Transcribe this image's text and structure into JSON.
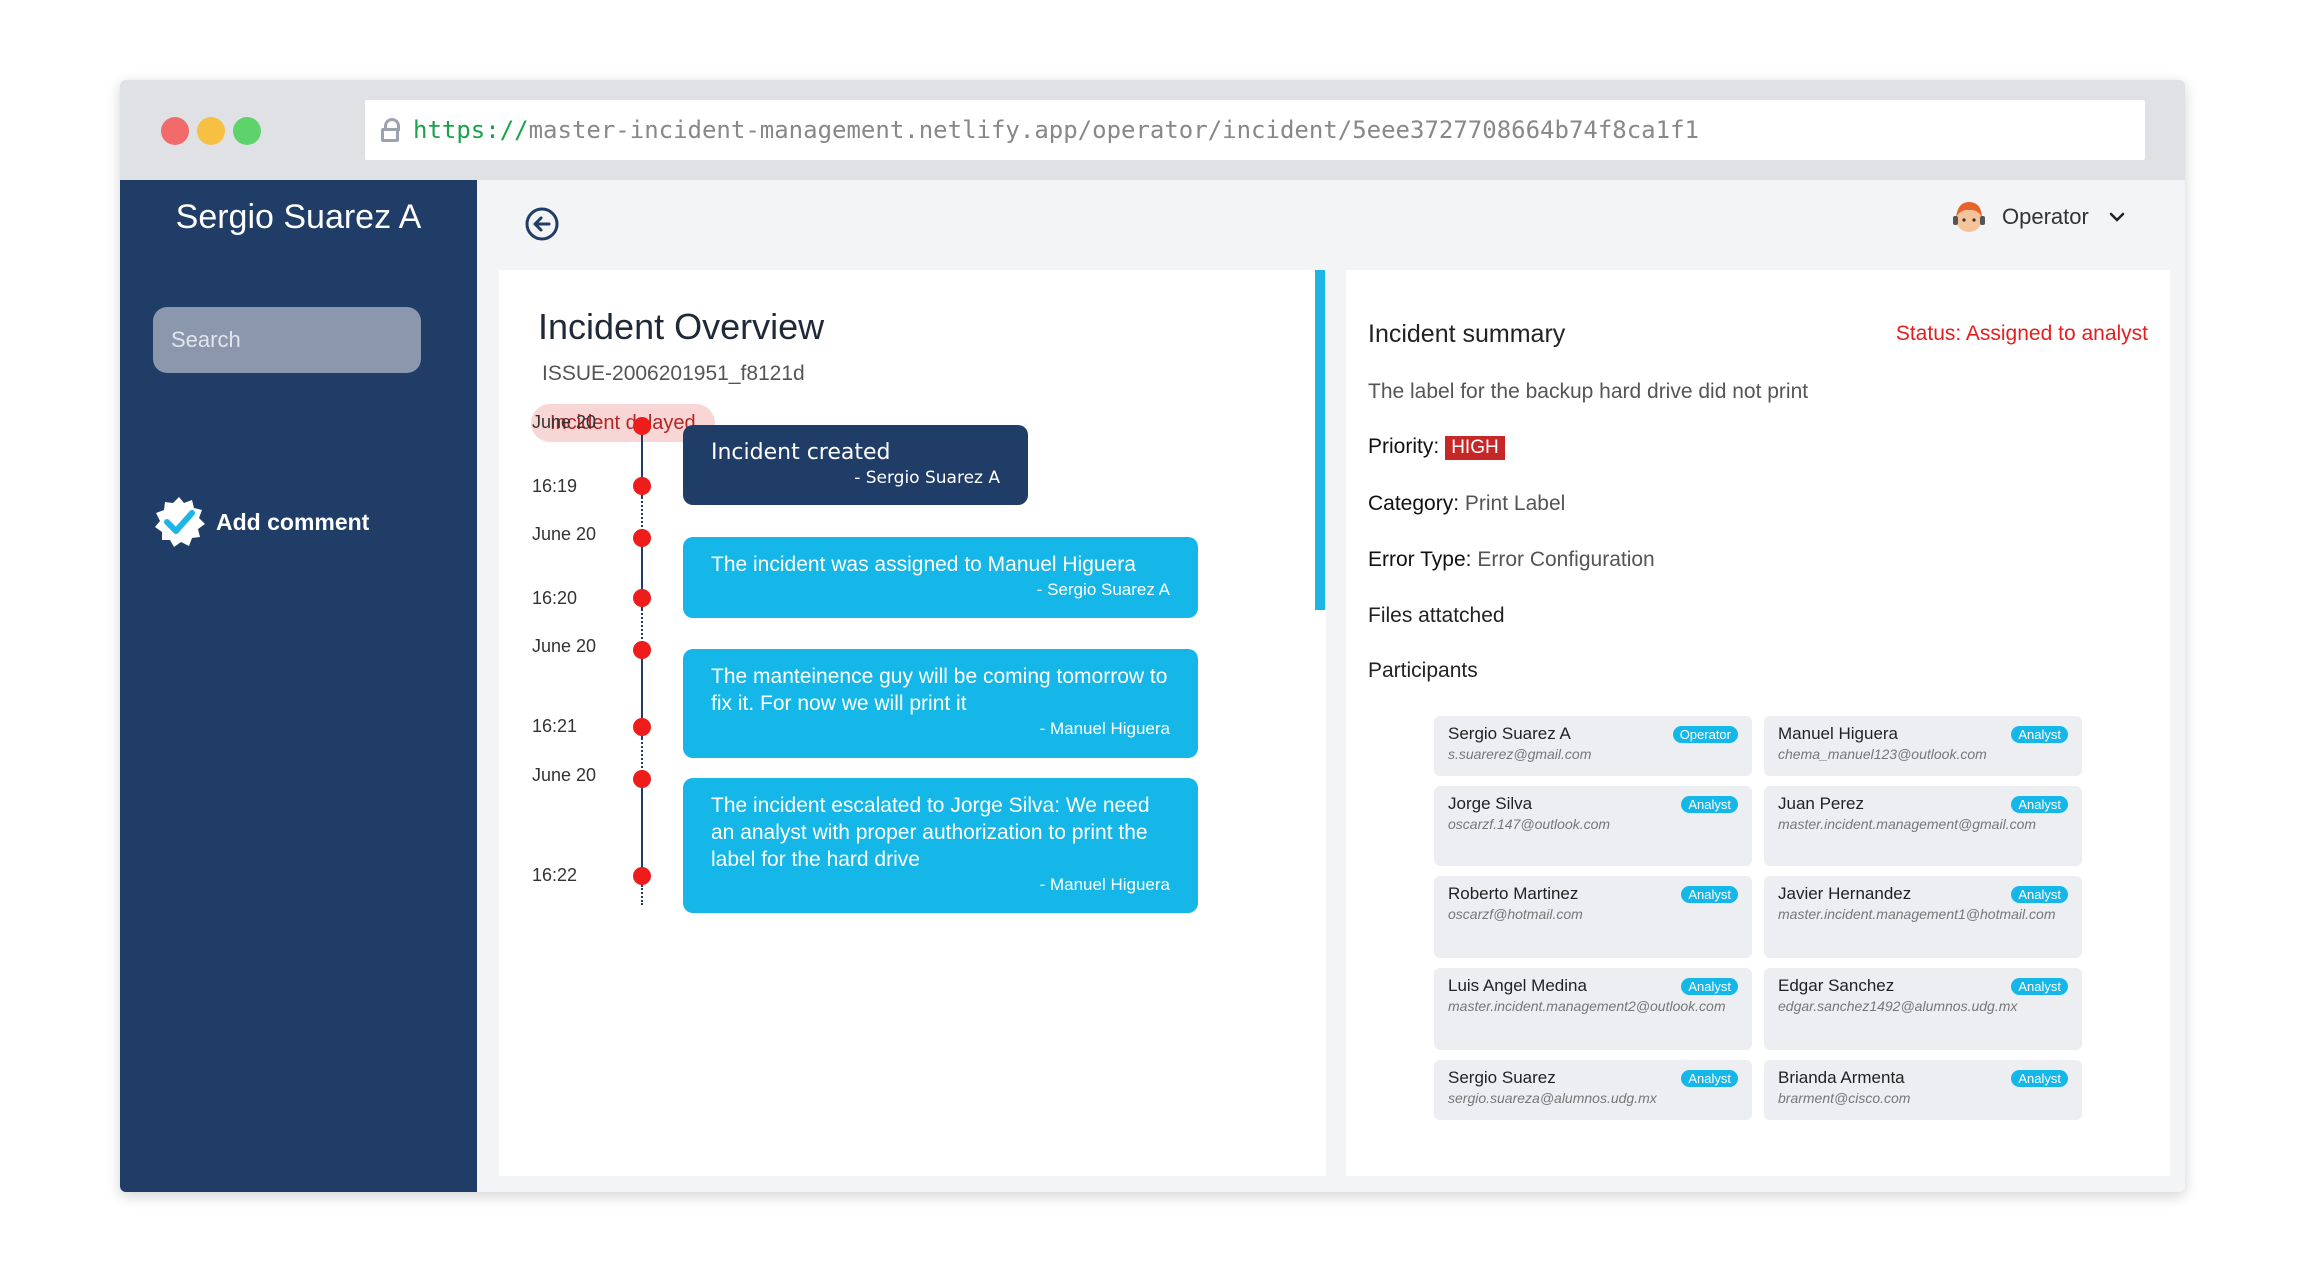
{
  "browser": {
    "url_protocol": "https://",
    "url_rest": "master-incident-management.netlify.app/operator/incident/5eee3727708664b74f8ca1f1"
  },
  "sidebar": {
    "user_name": "Sergio Suarez A",
    "search_placeholder": "Search",
    "add_comment": "Add comment"
  },
  "header": {
    "role_label": "Operator"
  },
  "overview": {
    "title": "Incident Overview",
    "issue_id": "ISSUE-2006201951_f8121d",
    "delayed_badge": "Incident delayed",
    "timeline": [
      {
        "date": "June 20",
        "time": "16:19",
        "message": "Incident created",
        "author": "- Sergio Suarez A"
      },
      {
        "date": "June 20",
        "time": "16:20",
        "message": "The incident was assigned to Manuel Higuera",
        "author": "- Sergio Suarez A"
      },
      {
        "date": "June 20",
        "time": "16:21",
        "message": "The manteinence guy will be coming tomorrow to fix it. For now we will print it",
        "author": "- Manuel Higuera"
      },
      {
        "date": "June 20",
        "time": "16:22",
        "message": "The incident escalated to Jorge Silva: We need an analyst with proper authorization to print the label for the hard drive",
        "author": "- Manuel Higuera"
      }
    ]
  },
  "summary": {
    "title": "Incident summary",
    "status": "Status: Assigned to analyst",
    "description": "The label for the backup hard drive did not print",
    "priority_label": "Priority:",
    "priority_value": "HIGH",
    "category_label": "Category:",
    "category_value": "Print Label",
    "error_label": "Error Type:",
    "error_value": "Error Configuration",
    "files_label": "Files attatched",
    "participants_label": "Participants",
    "participants": [
      {
        "name": "Sergio Suarez A",
        "role": "Operator",
        "email": "s.suarerez@gmail.com"
      },
      {
        "name": "Manuel Higuera",
        "role": "Analyst",
        "email": "chema_manuel123@outlook.com"
      },
      {
        "name": "Jorge Silva",
        "role": "Analyst",
        "email": "oscarzf.147@outlook.com"
      },
      {
        "name": "Juan Perez",
        "role": "Analyst",
        "email": "master.incident.management@gmail.com"
      },
      {
        "name": "Roberto Martinez",
        "role": "Analyst",
        "email": "oscarzf@hotmail.com"
      },
      {
        "name": "Javier Hernandez",
        "role": "Analyst",
        "email": "master.incident.management1@hotmail.com"
      },
      {
        "name": "Luis Angel Medina",
        "role": "Analyst",
        "email": "master.incident.management2@outlook.com"
      },
      {
        "name": "Edgar Sanchez",
        "role": "Analyst",
        "email": "edgar.sanchez1492@alumnos.udg.mx"
      },
      {
        "name": "Sergio Suarez",
        "role": "Analyst",
        "email": "sergio.suareza@alumnos.udg.mx"
      },
      {
        "name": "Brianda Armenta",
        "role": "Analyst",
        "email": "brarment@cisco.com"
      }
    ]
  },
  "colors": {
    "sidebar": "#1f3d67",
    "accent": "#14b7e7",
    "status": "#e41e1e",
    "timeline_dot": "#ef1c1c"
  }
}
